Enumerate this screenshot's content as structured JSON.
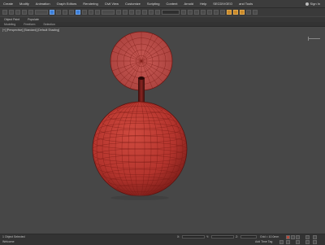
{
  "menu": [
    "Create",
    "Modify",
    "Animation",
    "Graph Editors",
    "Rendering",
    "Civil View",
    "Customize",
    "Scripting",
    "Content",
    "Arnold",
    "Help",
    "SECDIVGEO",
    "and Tools"
  ],
  "signin": "Sign In",
  "ribbon": [
    "Object Paint",
    "Populate"
  ],
  "ribbon2": [
    "Modeling",
    "Freeform",
    "Selection"
  ],
  "viewport": {
    "label": "[+] [Perspective] [Standard] [Default Shading]"
  },
  "status": {
    "left_top": "1 Object Selected",
    "left_bottom": "Welcome",
    "grid": "Grid = 10.0mm",
    "time_tag": "Add Time Tag",
    "coord_x": "X:",
    "coord_y": "Y:",
    "coord_z": "Z:"
  },
  "colors": {
    "mesh": "#b4342d",
    "mesh_line": "#7a1b16",
    "viewport_bg": "#474747"
  }
}
